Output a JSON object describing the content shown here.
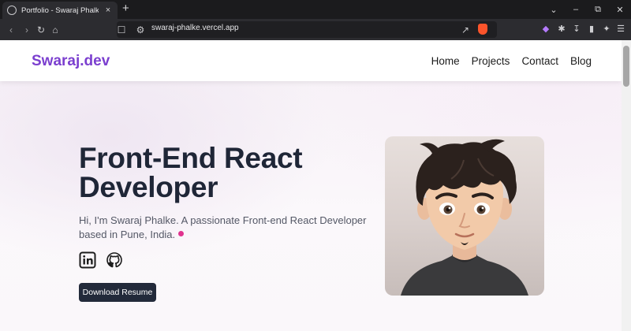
{
  "browser": {
    "tab_title": "Portfolio - Swaraj Phalke",
    "tab_close": "×",
    "new_tab": "+",
    "url": "swaraj-phalke.vercel.app",
    "window_controls": [
      "⌄",
      "–",
      "⧉",
      "✕"
    ]
  },
  "site": {
    "logo": "Swaraj.dev",
    "nav": [
      "Home",
      "Projects",
      "Contact",
      "Blog"
    ],
    "hero_title": "Front-End React Developer",
    "hero_subtitle": "Hi, I'm Swaraj Phalke. A passionate Front-end React Developer based in Pune, India.",
    "social_icons": [
      "linkedin-icon",
      "github-icon"
    ],
    "button_label": "Download Resume",
    "colors": {
      "accent": "#7b3fcf",
      "button": "#222a3a",
      "heading": "#1f2637",
      "pin": "#e0338f"
    }
  }
}
